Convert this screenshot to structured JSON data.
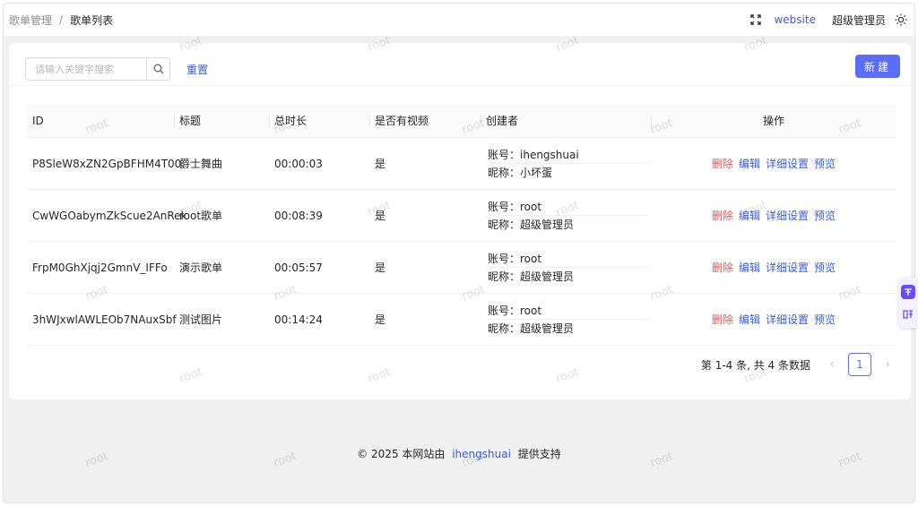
{
  "breadcrumb": {
    "parent": "歌单管理",
    "separator": "/",
    "current": "歌单列表"
  },
  "header": {
    "website_label": "website",
    "admin_label": "超级管理员"
  },
  "toolbar": {
    "search_placeholder": "请输入关键字搜索",
    "reset_label": "重置",
    "new_label": "新建"
  },
  "table": {
    "columns": [
      "ID",
      "标题",
      "总时长",
      "是否有视频",
      "创建者",
      "操作"
    ],
    "rows": [
      {
        "id": "P8SleW8xZN2GpBFHM4T00",
        "title": "爵士舞曲",
        "duration": "00:00:03",
        "has_video": "是",
        "account": "账号：ihengshuai",
        "nickname": "昵称：小坏蛋"
      },
      {
        "id": "CwWGOabymZkScue2AnRek",
        "title": "root歌单",
        "duration": "00:08:39",
        "has_video": "是",
        "account": "账号：root",
        "nickname": "昵称：超级管理员"
      },
      {
        "id": "FrpM0GhXjqj2GmnV_IFFo",
        "title": "演示歌单",
        "duration": "00:05:57",
        "has_video": "是",
        "account": "账号：root",
        "nickname": "昵称：超级管理员"
      },
      {
        "id": "3hWJxwlAWLEOb7NAuxSbf",
        "title": "测试图片",
        "duration": "00:14:24",
        "has_video": "是",
        "account": "账号：root",
        "nickname": "昵称：超级管理员"
      }
    ],
    "actions": {
      "delete": "删除",
      "edit": "编辑",
      "settings": "详细设置",
      "preview": "预览"
    }
  },
  "pagination": {
    "summary": "第 1-4 条, 共 4 条数据",
    "current_page": "1",
    "prev": "‹",
    "next": "›"
  },
  "footer": {
    "copyright": "©  2025  本网站由",
    "brand": "ihengshuai",
    "suffix": "提供支持"
  },
  "watermark": "root",
  "colors": {
    "primary": "#5b6cf5",
    "link": "#3b5bdb",
    "danger": "#f5504a"
  }
}
